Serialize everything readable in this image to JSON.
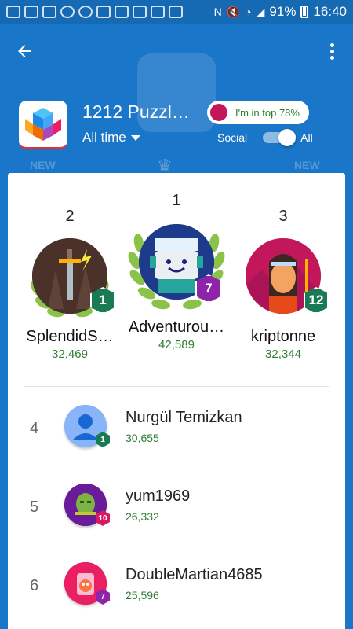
{
  "status_bar": {
    "battery": "91%",
    "time": "16:40"
  },
  "header": {
    "game_title": "1212 Puzzl…",
    "period": "All time",
    "rank_chip": "I'm in top 78%",
    "toggle_left": "Social",
    "toggle_right": "All",
    "bg_new_left": "NEW",
    "bg_new_right": "NEW"
  },
  "podium": [
    {
      "rank": "2",
      "name": "SplendidS…",
      "score": "32,469",
      "level": "1",
      "level_color": "#1a7a55"
    },
    {
      "rank": "1",
      "name": "Adventurou…",
      "score": "42,589",
      "level": "7",
      "level_color": "#8e24aa"
    },
    {
      "rank": "3",
      "name": "kriptonne",
      "score": "32,344",
      "level": "12",
      "level_color": "#1a7a55"
    }
  ],
  "rows": [
    {
      "rank": "4",
      "name": "Nurgül Temizkan",
      "score": "30,655",
      "level": "1",
      "level_color": "#1a7a55"
    },
    {
      "rank": "5",
      "name": "yum1969",
      "score": "26,332",
      "level": "10",
      "level_color": "#d81b60"
    },
    {
      "rank": "6",
      "name": "DoubleMartian4685",
      "score": "25,596",
      "level": "7",
      "level_color": "#8e24aa"
    }
  ]
}
